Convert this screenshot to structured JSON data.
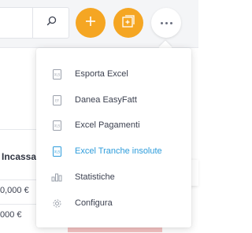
{
  "colors": {
    "accent_orange": "#f5a623",
    "active_blue": "#2d9cdb",
    "text_dark": "#3c4150",
    "icon_gray": "#9aa0ab"
  },
  "toolbar": {
    "search_icon": "search-icon",
    "add_icon": "plus-icon",
    "doc_icon": "add-document-icon",
    "more_icon": "more-dots-icon"
  },
  "table": {
    "column_header": "Incassare",
    "cells": [
      "0,000 €",
      "000 €"
    ]
  },
  "menu": {
    "items": [
      {
        "label": "Esporta Excel",
        "icon": "xls-file-icon",
        "active": false
      },
      {
        "label": "Danea EasyFatt",
        "icon": "easyfatt-file-icon",
        "active": false
      },
      {
        "label": "Excel Pagamenti",
        "icon": "xls-file-icon",
        "active": false
      },
      {
        "label": "Excel Tranche insolute",
        "icon": "xls-file-icon",
        "active": true
      },
      {
        "label": "Statistiche",
        "icon": "bar-chart-icon",
        "active": false
      },
      {
        "label": "Configura",
        "icon": "gear-icon",
        "active": false
      }
    ]
  },
  "side_tab": {
    "icon": "info-icon"
  }
}
